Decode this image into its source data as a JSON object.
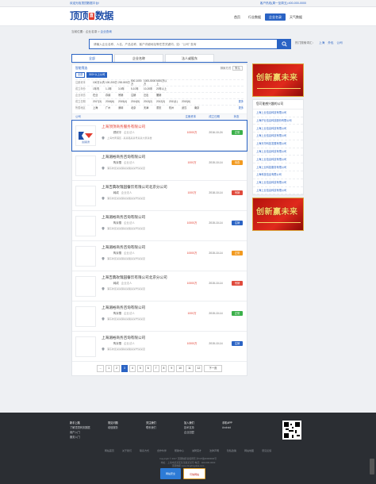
{
  "topbar": {
    "left": "欢迎光临顶顶数据平台!",
    "right": "客户热线(周一至周五):400-000-0000"
  },
  "logo": {
    "text1": "顶顶",
    "badge": "直",
    "text2": "数据"
  },
  "nav": [
    "首页",
    "行业数据",
    "企业名录",
    "天气数据"
  ],
  "nav_active": 2,
  "breadcrumb": {
    "prefix": "当前位置：",
    "home": "企业名录",
    "sep": " > ",
    "current": "企业查询"
  },
  "search": {
    "placeholder": "请输入企业名称、人名、产品名称、客户详细地址等任意关键词，如：\"公司\" 查询",
    "hot_label": "热门搜索词汇：",
    "hot": [
      "上海",
      "外包",
      "公司"
    ]
  },
  "tabs": [
    "全部",
    "企业名称",
    "法人或股东"
  ],
  "tabs_active": 0,
  "filter": {
    "title": "智能筛选",
    "current": [
      "全部",
      "500+以上公司"
    ],
    "sort": {
      "label": "排序方式",
      "value": "默认"
    },
    "rows": [
      {
        "label": "注册资本",
        "options": [
          "100万以内",
          "100-200万",
          "200-500万",
          "500-1000万",
          "1000-5000万",
          "5000万以上"
        ]
      },
      {
        "label": "成立年份",
        "options": [
          "1年内",
          "1-3年",
          "3-5年",
          "5-10年",
          "10-20年",
          "20年以上"
        ]
      },
      {
        "label": "企业状态",
        "options": [
          "在业",
          "存续",
          "吊销",
          "注销",
          "迁出",
          "撤销"
        ]
      },
      {
        "label": "成立日期",
        "options": [
          "2017(3)",
          "2016(6)",
          "2015(4)",
          "2014(5)",
          "2013(2)",
          "2012(3)",
          "2011(1)",
          "2010(6)"
        ],
        "more": "更多"
      },
      {
        "label": "所属地区",
        "options": [
          "上海",
          "广州",
          "深圳",
          "北京",
          "天津",
          "重庆",
          "杭州",
          "武汉",
          "南京"
        ],
        "more": "更多"
      }
    ]
  },
  "table_headers": [
    "公司",
    "注册资本",
    "成立日期",
    "状态"
  ],
  "rows": [
    {
      "name": "上海顶顶商务服务有限公司",
      "person": "顾欣平",
      "role": "企业法人",
      "addr": "上海市黄浦区...某某路某某号某某大厦某楼",
      "capital": "10000万",
      "date": "2016-10-24",
      "status": "正常",
      "color": "#3bb04a",
      "highlight": true,
      "logo_text": "顶顶商务"
    },
    {
      "name": "上海湄裕商务咨询有限公司",
      "person": "陶京雪",
      "role": "企业法人",
      "addr": "浦东新区某某镇某某路某某号某某室",
      "capital": "1000万",
      "date": "2015-10-14",
      "status": "待查",
      "color": "#f29a1f"
    },
    {
      "name": "上海吉典玫瑰园餐饮有限公司北京分公司",
      "person": "韩成",
      "role": "企业法人",
      "addr": "浦东新区某某镇某某路某某号某某室",
      "capital": "1000万",
      "date": "2018-10-14",
      "status": "吊销",
      "color": "#e04a3c"
    },
    {
      "name": "上海湄裕商务咨询有限公司",
      "person": "陶京雪",
      "role": "企业法人",
      "addr": "浦东新区某某镇某某路某某号某某室",
      "capital": "10000万",
      "date": "2015-10-14",
      "status": "注销",
      "color": "#2a63c4"
    },
    {
      "name": "上海湄裕商务咨询有限公司",
      "person": "陶京雪",
      "role": "企业法人",
      "addr": "浦东新区某某镇某某路某某号某某室",
      "capital": "10000万",
      "date": "2015-10-14",
      "status": "正常",
      "color": "#f29a1f"
    },
    {
      "name": "上海吉典玫瑰园餐饮有限公司北京分公司",
      "person": "韩成",
      "role": "企业法人",
      "addr": "浦东新区某某镇某某路某某号某某室",
      "capital": "10000万",
      "date": "2015-10-14",
      "status": "吊销",
      "color": "#e04a3c"
    },
    {
      "name": "上海湄裕商务咨询有限公司",
      "person": "陶京雪",
      "role": "企业法人",
      "addr": "浦东新区某某镇某某路某某号某某室",
      "capital": "1000万",
      "date": "2015-10-14",
      "status": "正常",
      "color": "#3bb04a"
    },
    {
      "name": "上海湄裕商务咨询有限公司",
      "person": "陶京雪",
      "role": "企业法人",
      "addr": "浦东新区某某镇某某路某某号某某室",
      "capital": "10000万",
      "date": "2015-10-14",
      "status": "注销",
      "color": "#2a63c4"
    }
  ],
  "pager": {
    "pages": [
      "1",
      "2",
      "3",
      "4",
      "5",
      "6",
      "7",
      "8",
      "9",
      "10",
      "11",
      "12"
    ],
    "active": 2,
    "prev_dots": "...",
    "next": "下一页"
  },
  "side": {
    "banner_text": "创新赢未来",
    "list_title": "您可能感兴趣的公司",
    "items": [
      "上海上业信息科技有限公司",
      "上海沪业信息科技股份有限公司",
      "上海上业信息科技有限公司",
      "上海上业信息科技有限公司",
      "上海天华科技发展有限公司",
      "上海上业信息科技有限公司",
      "上海上业信息科技有限公司",
      "上海上业科技服务有限公司",
      "上海科技信息有限公司",
      "上海上业信息科技有限公司",
      "上海上业信息科技有限公司"
    ],
    "banner2_text": "创新赢未来"
  },
  "footer": {
    "cols": [
      {
        "title": "新手上路",
        "items": [
          "了解顶顶商务数据",
          "用户入门",
          "服务入门"
        ]
      },
      {
        "title": "常见问题",
        "items": [
          "增值服务"
        ]
      },
      {
        "title": "关注我们",
        "items": [
          "联系我们"
        ]
      },
      {
        "title": "加入我们",
        "items": [
          "技术支持",
          "企业加盟"
        ]
      },
      {
        "title": "手机APP",
        "items": [
          "Android"
        ]
      }
    ],
    "links": [
      "网站首页",
      "关于我们",
      "联系方式",
      "合作伙伴",
      "帮助中心",
      "诚聘英才",
      "法律声明",
      "隐私政策",
      "网站地图",
      "意见反馈"
    ],
    "copy1": "Copyright © 2017 顶顶数据 版权所有 沪ICP备00000000号",
    "copy2": "地址：上海市某某区某某路某某号 电话：400-000-0000",
    "copy3": "顶顶数据 www.dingdingdata.com",
    "badge1": "网站安全",
    "badge2": "可信网站"
  }
}
